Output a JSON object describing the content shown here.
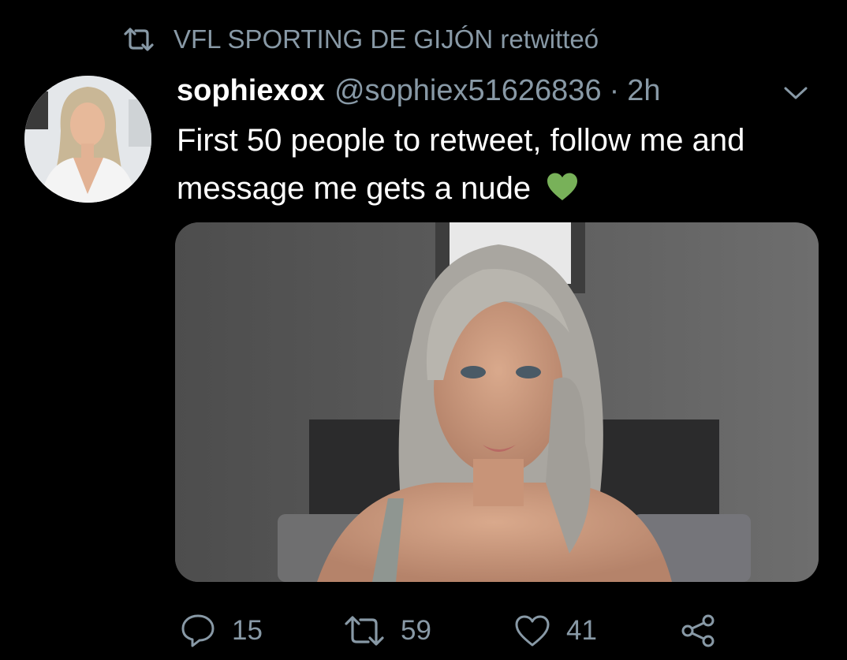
{
  "retweet": {
    "icon": "retweet-icon",
    "text": "VFL SPORTING DE GIJÓN retwitteó"
  },
  "tweet": {
    "avatar": "profile-photo",
    "display_name": "sophiexox",
    "handle": "@sophiex51626836",
    "separator": "·",
    "time": "2h",
    "text": "First 50 people to retweet, follow me and message me gets a nude",
    "emoji": "green-heart-emoji",
    "media": "attached-photo"
  },
  "actions": {
    "reply_count": "15",
    "retweet_count": "59",
    "like_count": "41"
  },
  "colors": {
    "background": "#000000",
    "primary_text": "#ffffff",
    "secondary_text": "#8899a6",
    "emoji_green": "#78b159"
  }
}
